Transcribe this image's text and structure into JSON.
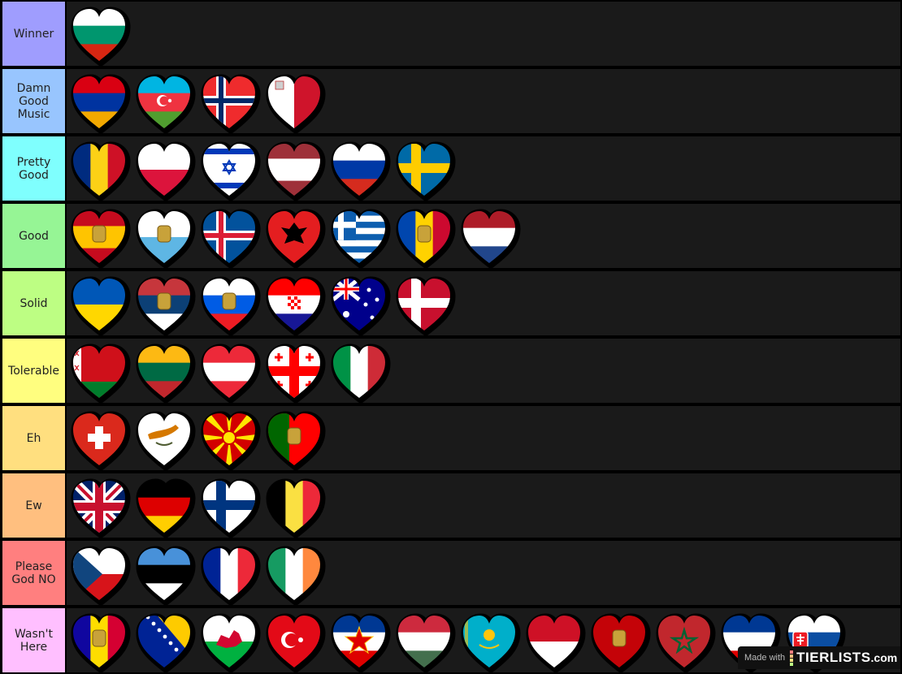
{
  "colors": {
    "background": "#000000",
    "row_bg": "#1a1a1a",
    "label_text": "#222222"
  },
  "tiers": [
    {
      "label": "Winner",
      "color": "#9f9dfe",
      "items": [
        {
          "country": "Bulgaria",
          "flag": {
            "type": "h",
            "colors": [
              "#ffffff",
              "#00966e",
              "#d62612"
            ]
          }
        }
      ]
    },
    {
      "label": "Damn Good Music",
      "color": "#98c5fe",
      "items": [
        {
          "country": "Armenia",
          "flag": {
            "type": "h",
            "colors": [
              "#d90012",
              "#0033a0",
              "#f2a800"
            ]
          }
        },
        {
          "country": "Azerbaijan",
          "flag": {
            "type": "h",
            "colors": [
              "#00b5e2",
              "#ef3340",
              "#509e2f"
            ],
            "emblem": "crescent-star"
          }
        },
        {
          "country": "Norway",
          "flag": {
            "type": "nordic",
            "colors": [
              "#ef2b2d",
              "#ffffff",
              "#002868"
            ]
          }
        },
        {
          "country": "Malta",
          "flag": {
            "type": "v",
            "colors": [
              "#ffffff",
              "#cf142b"
            ],
            "emblem": "george-cross"
          }
        }
      ]
    },
    {
      "label": "Pretty Good",
      "color": "#7ffffe",
      "items": [
        {
          "country": "Romania",
          "flag": {
            "type": "v",
            "colors": [
              "#002b7f",
              "#fcd116",
              "#ce1126"
            ]
          }
        },
        {
          "country": "Poland",
          "flag": {
            "type": "h",
            "colors": [
              "#ffffff",
              "#dc143c"
            ]
          }
        },
        {
          "country": "Israel",
          "flag": {
            "type": "israel",
            "colors": [
              "#ffffff",
              "#0038b8"
            ]
          }
        },
        {
          "country": "Latvia",
          "flag": {
            "type": "hw",
            "colors": [
              "#9e3039",
              "#ffffff",
              "#9e3039"
            ]
          }
        },
        {
          "country": "Russia",
          "flag": {
            "type": "h",
            "colors": [
              "#ffffff",
              "#0039a6",
              "#d52b1e"
            ]
          }
        },
        {
          "country": "Sweden",
          "flag": {
            "type": "nordic",
            "colors": [
              "#006aa7",
              "#fecc00",
              "#fecc00"
            ]
          }
        }
      ]
    },
    {
      "label": "Good",
      "color": "#96f595",
      "items": [
        {
          "country": "Spain",
          "flag": {
            "type": "hw",
            "colors": [
              "#c60b1e",
              "#ffc400",
              "#c60b1e"
            ],
            "emblem": "coat"
          }
        },
        {
          "country": "San Marino",
          "flag": {
            "type": "h",
            "colors": [
              "#ffffff",
              "#5eb6e4"
            ],
            "emblem": "coat"
          }
        },
        {
          "country": "Iceland",
          "flag": {
            "type": "nordic",
            "colors": [
              "#02529c",
              "#ffffff",
              "#dc1e35"
            ]
          }
        },
        {
          "country": "Albania",
          "flag": {
            "type": "solid",
            "colors": [
              "#e41e20"
            ],
            "emblem": "eagle"
          }
        },
        {
          "country": "Greece",
          "flag": {
            "type": "greece",
            "colors": [
              "#0d5eaf",
              "#ffffff"
            ]
          }
        },
        {
          "country": "Moldova",
          "flag": {
            "type": "v",
            "colors": [
              "#0046ae",
              "#ffd200",
              "#cc092f"
            ],
            "emblem": "coat"
          }
        },
        {
          "country": "Netherlands",
          "flag": {
            "type": "h",
            "colors": [
              "#ae1c28",
              "#ffffff",
              "#21468b"
            ]
          }
        }
      ]
    },
    {
      "label": "Solid",
      "color": "#bdfe83",
      "items": [
        {
          "country": "Ukraine",
          "flag": {
            "type": "h",
            "colors": [
              "#0057b7",
              "#ffd700"
            ]
          }
        },
        {
          "country": "Serbia",
          "flag": {
            "type": "h",
            "colors": [
              "#c6363c",
              "#0c4076",
              "#ffffff"
            ],
            "emblem": "coat"
          }
        },
        {
          "country": "Slovenia",
          "flag": {
            "type": "h",
            "colors": [
              "#ffffff",
              "#005ce5",
              "#ed1c24"
            ],
            "emblem": "coat"
          }
        },
        {
          "country": "Croatia",
          "flag": {
            "type": "h",
            "colors": [
              "#ff0000",
              "#ffffff",
              "#171796"
            ],
            "emblem": "checker"
          }
        },
        {
          "country": "Australia",
          "flag": {
            "type": "australia",
            "colors": [
              "#00008b",
              "#ffffff",
              "#ff0000"
            ]
          }
        },
        {
          "country": "Denmark",
          "flag": {
            "type": "nordic",
            "colors": [
              "#c8102e",
              "#ffffff",
              "#ffffff"
            ]
          }
        }
      ]
    },
    {
      "label": "Tolerable",
      "color": "#fffe7f",
      "items": [
        {
          "country": "Belarus",
          "flag": {
            "type": "belarus",
            "colors": [
              "#cf101a",
              "#007d2c",
              "#ffffff"
            ]
          }
        },
        {
          "country": "Lithuania",
          "flag": {
            "type": "h",
            "colors": [
              "#fdb913",
              "#006a44",
              "#c1272d"
            ]
          }
        },
        {
          "country": "Austria",
          "flag": {
            "type": "h",
            "colors": [
              "#ed2939",
              "#ffffff",
              "#ed2939"
            ]
          }
        },
        {
          "country": "Georgia",
          "flag": {
            "type": "georgia",
            "colors": [
              "#ffffff",
              "#ff0000"
            ]
          }
        },
        {
          "country": "Italy",
          "flag": {
            "type": "v",
            "colors": [
              "#009246",
              "#ffffff",
              "#ce2b37"
            ]
          }
        }
      ]
    },
    {
      "label": "Eh",
      "color": "#ffdf7f",
      "items": [
        {
          "country": "Switzerland",
          "flag": {
            "type": "swiss",
            "colors": [
              "#da291c",
              "#ffffff"
            ]
          }
        },
        {
          "country": "Cyprus",
          "flag": {
            "type": "solid",
            "colors": [
              "#ffffff"
            ],
            "emblem": "cyprus"
          }
        },
        {
          "country": "North Macedonia",
          "flag": {
            "type": "macedonia",
            "colors": [
              "#d20000",
              "#ffe600"
            ]
          }
        },
        {
          "country": "Portugal",
          "flag": {
            "type": "vp",
            "colors": [
              "#006600",
              "#ff0000"
            ],
            "emblem": "coat"
          }
        }
      ]
    },
    {
      "label": "Ew",
      "color": "#ffbf7f",
      "items": [
        {
          "country": "United Kingdom",
          "flag": {
            "type": "uk",
            "colors": [
              "#012169",
              "#ffffff",
              "#c8102e"
            ]
          }
        },
        {
          "country": "Germany",
          "flag": {
            "type": "h",
            "colors": [
              "#000000",
              "#dd0000",
              "#ffce00"
            ]
          }
        },
        {
          "country": "Finland",
          "flag": {
            "type": "nordic",
            "colors": [
              "#ffffff",
              "#003580",
              "#003580"
            ]
          }
        },
        {
          "country": "Belgium",
          "flag": {
            "type": "v",
            "colors": [
              "#000000",
              "#fae042",
              "#ed2939"
            ]
          }
        }
      ]
    },
    {
      "label": "Please God NO",
      "color": "#ff7f7f",
      "items": [
        {
          "country": "Czech Republic",
          "flag": {
            "type": "czech",
            "colors": [
              "#ffffff",
              "#d7141a",
              "#11457e"
            ]
          }
        },
        {
          "country": "Estonia",
          "flag": {
            "type": "h",
            "colors": [
              "#4891d9",
              "#000000",
              "#ffffff"
            ]
          }
        },
        {
          "country": "France",
          "flag": {
            "type": "v",
            "colors": [
              "#002395",
              "#ffffff",
              "#ed2939"
            ]
          }
        },
        {
          "country": "Ireland",
          "flag": {
            "type": "v",
            "colors": [
              "#169b62",
              "#ffffff",
              "#ff883e"
            ]
          }
        }
      ]
    },
    {
      "label": "Wasn't Here",
      "color": "#ffbfff",
      "items": [
        {
          "country": "Andorra",
          "flag": {
            "type": "v",
            "colors": [
              "#10069f",
              "#fedd00",
              "#d50032"
            ],
            "emblem": "coat"
          }
        },
        {
          "country": "Bosnia and Herzegovina",
          "flag": {
            "type": "bosnia",
            "colors": [
              "#002395",
              "#fecb00",
              "#ffffff"
            ]
          }
        },
        {
          "country": "Wales",
          "flag": {
            "type": "h",
            "colors": [
              "#ffffff",
              "#00b140"
            ],
            "emblem": "dragon"
          }
        },
        {
          "country": "Turkey",
          "flag": {
            "type": "solid",
            "colors": [
              "#e30a17"
            ],
            "emblem": "turkey"
          }
        },
        {
          "country": "Yugoslavia",
          "flag": {
            "type": "h",
            "colors": [
              "#003893",
              "#ffffff",
              "#de0000"
            ],
            "emblem": "red-star"
          }
        },
        {
          "country": "Hungary",
          "flag": {
            "type": "h",
            "colors": [
              "#cd2a3e",
              "#ffffff",
              "#436f4d"
            ]
          }
        },
        {
          "country": "Kazakhstan",
          "flag": {
            "type": "solid",
            "colors": [
              "#00afca"
            ],
            "emblem": "sun"
          }
        },
        {
          "country": "Monaco",
          "flag": {
            "type": "h",
            "colors": [
              "#ce1126",
              "#ffffff"
            ]
          }
        },
        {
          "country": "Montenegro",
          "flag": {
            "type": "solid",
            "colors": [
              "#c40308"
            ],
            "emblem": "coat"
          }
        },
        {
          "country": "Morocco",
          "flag": {
            "type": "solid",
            "colors": [
              "#c1272d"
            ],
            "emblem": "green-star"
          }
        },
        {
          "country": "Serbia and Montenegro",
          "flag": {
            "type": "h",
            "colors": [
              "#003893",
              "#ffffff",
              "#de0000"
            ]
          }
        },
        {
          "country": "Slovakia",
          "flag": {
            "type": "h",
            "colors": [
              "#ffffff",
              "#0b4ea2",
              "#ee1c25"
            ],
            "emblem": "slovak-cross"
          }
        }
      ]
    }
  ],
  "watermark": {
    "made_with": "Made with",
    "brand": "TIERLISTS",
    "brand_tld": ".com",
    "bar_colors": [
      "#ff7f7f",
      "#ffbf7f",
      "#ffdf7f",
      "#bdfe83"
    ]
  }
}
